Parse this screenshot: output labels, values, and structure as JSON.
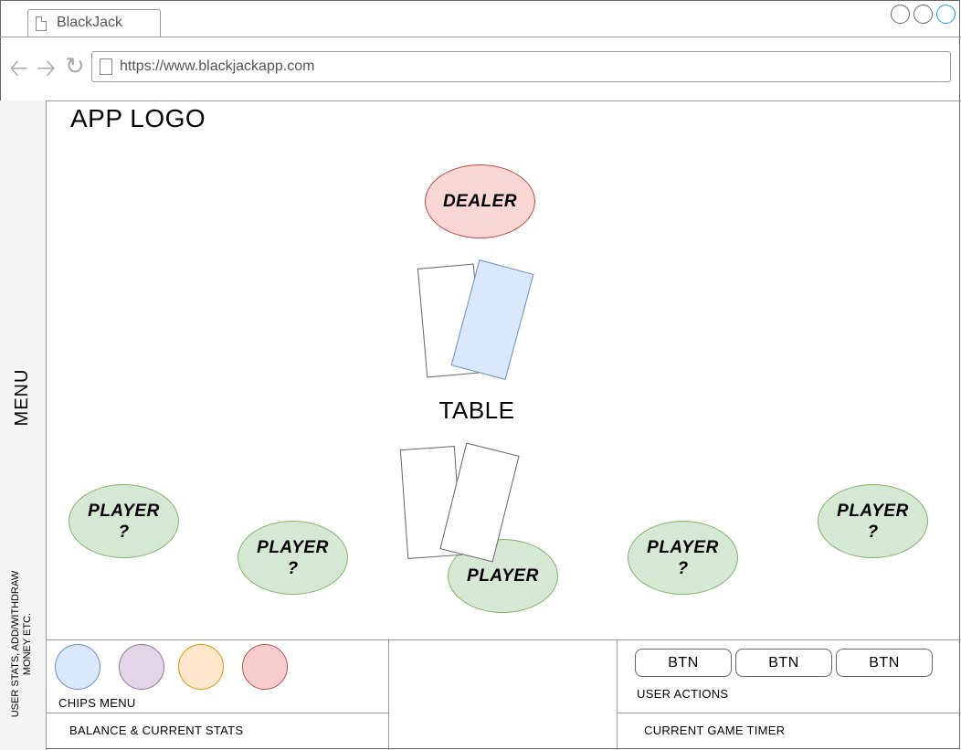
{
  "browser": {
    "tab_title": "BlackJack",
    "url": "https://www.blackjackapp.com",
    "accent_color": "#1ba1e2"
  },
  "sidebar": {
    "menu_label": "MENU",
    "stats_label": "USER STATS, ADD/WITHDRAW MONEY ETC."
  },
  "app": {
    "logo": "APP LOGO"
  },
  "game": {
    "dealer_label": "DEALER",
    "table_label": "TABLE",
    "player_label": "PLAYER",
    "other_players": [
      {
        "label": "PLAYER\n?"
      },
      {
        "label": "PLAYER\n?"
      },
      {
        "label": "PLAYER\n?"
      },
      {
        "label": "PLAYER\n?"
      }
    ]
  },
  "bottom": {
    "chips_label": "CHIPS MENU",
    "chips": [
      {
        "fill": "#dae8fc",
        "stroke": "#6c8ebf"
      },
      {
        "fill": "#e1d5e7",
        "stroke": "#9673a6"
      },
      {
        "fill": "#ffe6cc",
        "stroke": "#d79b00"
      },
      {
        "fill": "#f8cecc",
        "stroke": "#b85450"
      }
    ],
    "balance_label": "BALANCE & CURRENT STATS",
    "buttons": [
      "BTN",
      "BTN",
      "BTN"
    ],
    "actions_label": "USER ACTIONS",
    "timer_label": "CURRENT GAME TIMER"
  }
}
